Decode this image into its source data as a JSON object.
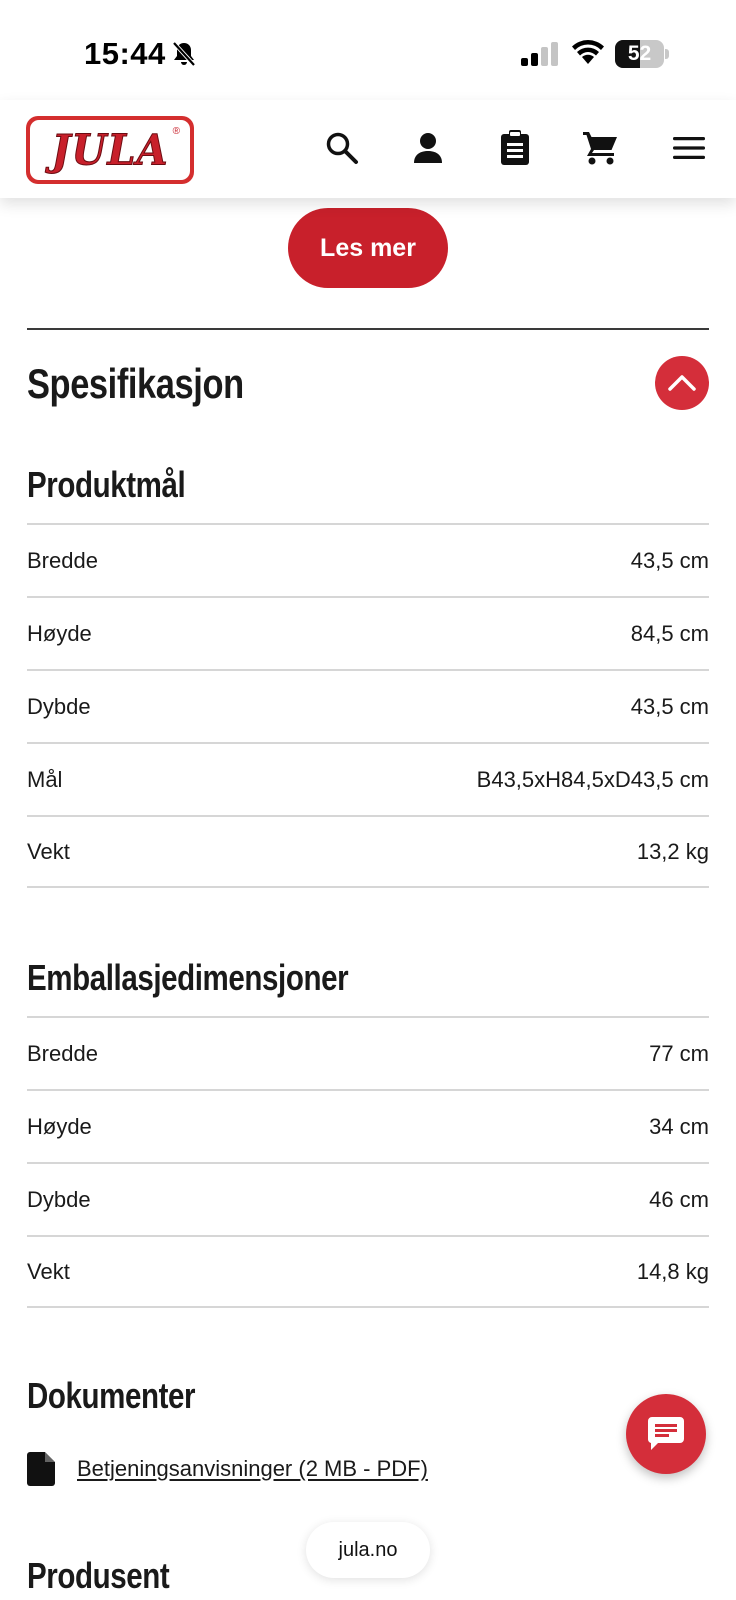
{
  "status_bar": {
    "time": "15:44",
    "battery_level": "52",
    "battery_fraction": 0.52
  },
  "header": {
    "logo_text": "JULA",
    "logo_registered": "®",
    "icons": [
      "search-icon",
      "user-icon",
      "clipboard-icon",
      "cart-icon",
      "menu-icon"
    ]
  },
  "content": {
    "read_more_label": "Les mer",
    "specification_title": "Spesifikasjon",
    "product_dimensions": {
      "title": "Produktmål",
      "rows": [
        {
          "label": "Bredde",
          "value": "43,5 cm"
        },
        {
          "label": "Høyde",
          "value": "84,5 cm"
        },
        {
          "label": "Dybde",
          "value": "43,5 cm"
        },
        {
          "label": "Mål",
          "value": "B43,5xH84,5xD43,5 cm"
        },
        {
          "label": "Vekt",
          "value": "13,2 kg"
        }
      ]
    },
    "package_dimensions": {
      "title": "Emballasjedimensjoner",
      "rows": [
        {
          "label": "Bredde",
          "value": "77 cm"
        },
        {
          "label": "Høyde",
          "value": "34 cm"
        },
        {
          "label": "Dybde",
          "value": "46 cm"
        },
        {
          "label": "Vekt",
          "value": "14,8 kg"
        }
      ]
    },
    "documents": {
      "title": "Dokumenter",
      "items": [
        {
          "label": "Betjeningsanvisninger (2 MB - PDF)"
        }
      ]
    },
    "manufacturer_title": "Produsent"
  },
  "browser": {
    "url": "jula.no"
  },
  "colors": {
    "brand_red": "#c8202b",
    "button_red": "#d42e3a",
    "divider": "#d6d6d6"
  }
}
